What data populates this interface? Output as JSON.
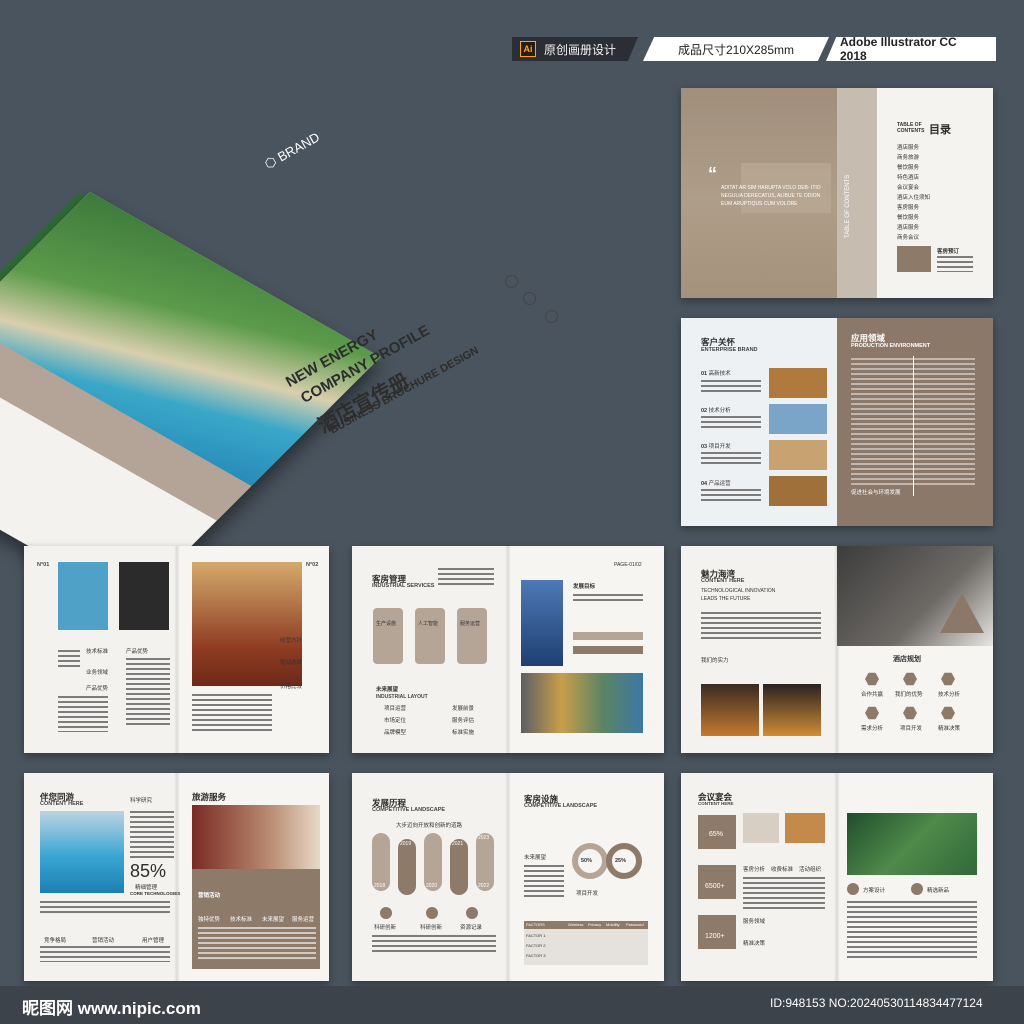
{
  "tags": {
    "ai_badge": "Ai",
    "original": "原创画册设计",
    "size": "成品尺寸210X285mm",
    "software": "Adobe Illustrator CC 2018"
  },
  "cover": {
    "brand": "BRAND",
    "title_en_1": "NEW ENERGY",
    "title_en_2": "COMPANY PROFILE",
    "title_cn": "酒店宣传册",
    "subtitle": "BUSINESS BROCHURE DESIGN"
  },
  "spread1": {
    "toc_label": "TABLE OF CONTENTS",
    "toc_title": "目录",
    "quote": "ADITAT AR SIM HARUPTA VOLO DEB- ITIO NEGULIA DERECATUS, ALIBUE TE ODION EUM ARUPTIQUS CUM VOLORE",
    "vertical": "TABLE OF CONTENTS",
    "items": [
      "酒店服务",
      "商务旅游",
      "餐饮服务",
      "特色酒店",
      "会议宴会",
      "酒店入住须知",
      "客房服务",
      "餐饮服务",
      "酒店服务",
      "商务会议"
    ],
    "bottom_label": "客房预订"
  },
  "spread2": {
    "left_title": "客户关怀",
    "left_sub": "ENTERPRISE BRAND",
    "items": [
      {
        "num": "01",
        "label": "高新技术"
      },
      {
        "num": "02",
        "label": "技术分析"
      },
      {
        "num": "03",
        "label": "项目开发"
      },
      {
        "num": "04",
        "label": "产品运营"
      }
    ],
    "right_title": "应用领域",
    "right_sub": "PRODUCTION ENVIRONMENT",
    "right_bottom": "促进社会与环境发展"
  },
  "spread3": {
    "no1": "N°01",
    "no2": "N°02",
    "labels_left": [
      "技术标准",
      "业务领域",
      "产品优势",
      "产品优势"
    ],
    "labels_right": [
      "经营方针",
      "驱动选择",
      "价格比较"
    ]
  },
  "spread4": {
    "title": "客房管理",
    "sub": "INDUSTRIAL SERVICES",
    "steps": [
      "生产设施",
      "人工智能",
      "服务运营"
    ],
    "future": "未来展望",
    "future_sub": "INDUSTRIAL LAYOUT",
    "features": [
      "项目运营",
      "发展前景",
      "市场定位",
      "服务评估",
      "品牌模型",
      "标准实施"
    ],
    "page": "PAGE-01/02",
    "goal": "发展目标"
  },
  "spread5": {
    "title": "魅力海湾",
    "sub": "CONTENT HERE",
    "desc1": "TECHNOLOGICAL INNOVATION",
    "desc2": "LEADS THE FUTURE",
    "strength": "我们的实力",
    "plan": "酒店规划",
    "icons": [
      "合作共赢",
      "我们的优势",
      "技术分析",
      "需求分析",
      "项目开发",
      "精准决策"
    ]
  },
  "spread6": {
    "title": "伴您同游",
    "sub": "CONTENT HERE",
    "research": "科学研究",
    "percent": "85%",
    "pm": "精细管理",
    "pm_sub": "CORE TECHNOLOGIES",
    "bottom": [
      "竞争格局",
      "营销活动",
      "用户管理"
    ],
    "right_title": "旅游服务",
    "marketing": "营销活动",
    "marketing_items": [
      "独特优势",
      "技术标准",
      "未来展望",
      "服务运营"
    ]
  },
  "spread7": {
    "title": "发展历程",
    "sub": "COMPETITIVE LANDSCAPE",
    "headline": "大步迈向开放和创新的道路",
    "years_top": [
      "2019",
      "2021",
      "2023"
    ],
    "years_bottom": [
      "2018",
      "2020",
      "2022"
    ],
    "circles": [
      "科研创新",
      "科研创新",
      "资源记录"
    ],
    "right_title": "客房设施",
    "right_sub": "COMPETITIVE LANDSCAPE",
    "future": "未来展望",
    "p1": "50%",
    "p2": "25%",
    "project": "项目开发",
    "table_head": [
      "FACTORS",
      "Wireless",
      "Privacy",
      "Mobility",
      "Password"
    ],
    "table_rows": [
      "FACTOR 1",
      "FACTOR 2",
      "FACTOR 3"
    ]
  },
  "spread8": {
    "title": "会议宴会",
    "sub": "CONTENT HERE",
    "stats": [
      "65%",
      "6500+",
      "1200+"
    ],
    "icon_labels": [
      "客房分析",
      "收费标准",
      "活动组织"
    ],
    "services": "服务领域",
    "decision": "精准决策",
    "right_labels": [
      "方案设计",
      "精选新品"
    ]
  },
  "footer": {
    "logo": "昵图网 www.nipic.com",
    "id": "ID:948153 NO:20240530114834477124"
  }
}
